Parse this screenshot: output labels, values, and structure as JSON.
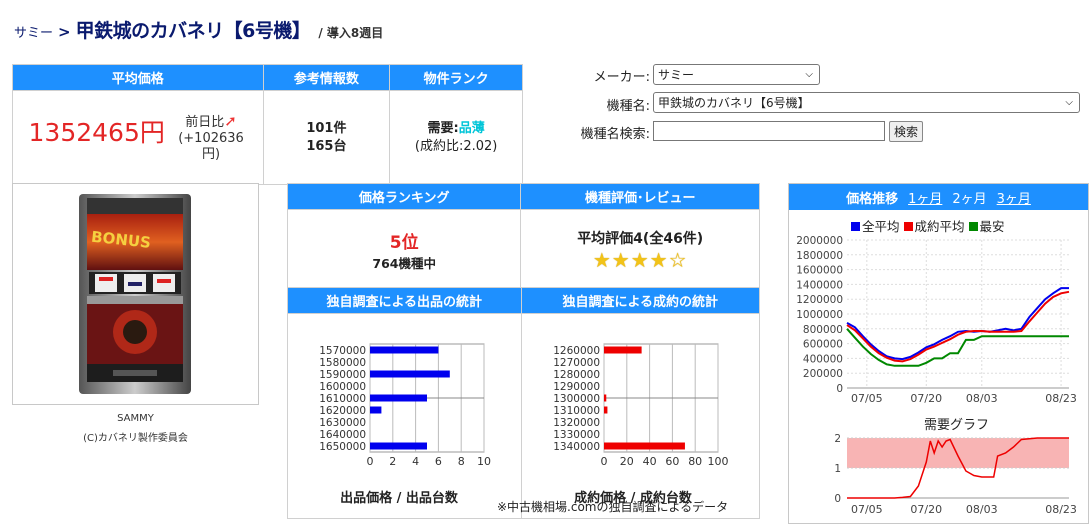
{
  "breadcrumb": {
    "maker": "サミー",
    "separator": ">",
    "title": "甲鉄城のカバネリ【6号機】",
    "subtitle": "/ 導入8週目"
  },
  "summary": {
    "headers": [
      "平均価格",
      "参考情報数",
      "物件ランク"
    ],
    "avg_price": "1352465円",
    "prev_label": "前日比",
    "prev_arrow": "➚",
    "prev_diff": "(+102636円)",
    "info_count": "101件",
    "info_units": "165台",
    "demand_label": "需要:",
    "demand_value": "品薄",
    "contract_ratio": "(成約比:2.02)"
  },
  "form": {
    "maker_label": "メーカー:",
    "maker_value": "サミー",
    "model_label": "機種名:",
    "model_value": "甲鉄城のカバネリ【6号機】",
    "search_label": "機種名検索:",
    "search_value": "",
    "search_button": "検索"
  },
  "machine": {
    "caption1": "SAMMY",
    "caption2": "(C)カバネリ製作委員会",
    "banner": "BONUS"
  },
  "rank": {
    "headers": [
      "価格ランキング",
      "機種評価･レビュー"
    ],
    "rank_value": "5位",
    "rank_total": "764機種中",
    "review_text": "平均評価4(全46件)",
    "stars": "★★★★☆"
  },
  "stats": {
    "headers": [
      "独自調査による出品の統計",
      "独自調査による成約の統計"
    ],
    "listing_caption": "出品価格 / 出品台数",
    "contract_caption": "成約価格 / 成約台数",
    "note": "※中古機相場.comの独自調査によるデータ"
  },
  "trend": {
    "title": "価格推移",
    "periods": [
      "1ヶ月",
      "2ヶ月",
      "3ヶ月"
    ],
    "legend": [
      {
        "label": "全平均",
        "color": "#0000ee"
      },
      {
        "label": "成約平均",
        "color": "#ee0000"
      },
      {
        "label": "最安",
        "color": "#008800"
      }
    ],
    "demand_title": "需要グラフ"
  },
  "chart_data": [
    {
      "type": "bar",
      "orientation": "horizontal",
      "categories": [
        "1570000",
        "1580000",
        "1590000",
        "1600000",
        "1610000",
        "1620000",
        "1630000",
        "1640000",
        "1650000"
      ],
      "values": [
        6,
        0,
        7,
        0,
        5,
        1,
        0,
        0,
        5
      ],
      "xlim": [
        0,
        10
      ],
      "xticks": [
        0,
        2,
        4,
        6,
        8,
        10
      ],
      "color": "#0000ee",
      "xlabel": "出品価格 / 出品台数"
    },
    {
      "type": "bar",
      "orientation": "horizontal",
      "categories": [
        "1260000",
        "1270000",
        "1280000",
        "1290000",
        "1300000",
        "1310000",
        "1320000",
        "1330000",
        "1340000"
      ],
      "values": [
        33,
        0,
        0,
        0,
        2,
        3,
        0,
        0,
        71
      ],
      "xlim": [
        0,
        100
      ],
      "xticks": [
        0,
        20,
        40,
        60,
        80,
        100
      ],
      "color": "#ee0000",
      "xlabel": "成約価格 / 成約台数"
    },
    {
      "type": "line",
      "x": [
        0,
        2,
        4,
        6,
        8,
        10,
        12,
        14,
        16,
        18,
        20,
        22,
        24,
        26,
        28,
        30,
        32,
        34,
        36,
        38,
        40,
        42,
        44,
        46,
        48,
        50,
        52,
        54,
        56
      ],
      "xticks": [
        {
          "pos": 5,
          "label": "07/05"
        },
        {
          "pos": 20,
          "label": "07/20"
        },
        {
          "pos": 34,
          "label": "08/03"
        },
        {
          "pos": 54,
          "label": "08/23"
        }
      ],
      "ylim": [
        0,
        2000000
      ],
      "yticks": [
        0,
        200000,
        400000,
        600000,
        800000,
        1000000,
        1200000,
        1400000,
        1600000,
        1800000,
        2000000
      ],
      "series": [
        {
          "name": "全平均",
          "color": "#0000ee",
          "values": [
            880000,
            820000,
            700000,
            590000,
            500000,
            430000,
            400000,
            390000,
            420000,
            480000,
            550000,
            590000,
            650000,
            700000,
            760000,
            770000,
            760000,
            770000,
            760000,
            780000,
            800000,
            780000,
            800000,
            960000,
            1080000,
            1200000,
            1280000,
            1350000,
            1350000
          ]
        },
        {
          "name": "成約平均",
          "color": "#ee0000",
          "values": [
            850000,
            780000,
            670000,
            560000,
            470000,
            410000,
            370000,
            360000,
            390000,
            450000,
            520000,
            560000,
            610000,
            660000,
            720000,
            760000,
            770000,
            770000,
            760000,
            760000,
            760000,
            760000,
            770000,
            900000,
            1020000,
            1140000,
            1230000,
            1280000,
            1300000
          ]
        },
        {
          "name": "最安",
          "color": "#008800",
          "values": [
            800000,
            680000,
            560000,
            460000,
            380000,
            320000,
            300000,
            300000,
            300000,
            300000,
            340000,
            400000,
            400000,
            470000,
            470000,
            650000,
            650000,
            700000,
            700000,
            700000,
            700000,
            700000,
            700000,
            700000,
            700000,
            700000,
            700000,
            700000,
            700000
          ]
        }
      ]
    },
    {
      "type": "line",
      "title": "需要グラフ",
      "x": [
        0,
        4,
        8,
        12,
        14,
        16,
        18,
        20,
        21,
        22,
        23,
        24,
        25,
        26,
        28,
        30,
        32,
        34,
        35,
        36,
        37,
        38,
        40,
        42,
        44,
        48,
        52,
        56
      ],
      "ylim": [
        0,
        2
      ],
      "yticks": [
        0,
        1,
        2
      ],
      "xticks": [
        {
          "pos": 5,
          "label": "07/05"
        },
        {
          "pos": 20,
          "label": "07/20"
        },
        {
          "pos": 34,
          "label": "08/03"
        },
        {
          "pos": 54,
          "label": "08/23"
        }
      ],
      "band": [
        1,
        2
      ],
      "series": [
        {
          "name": "",
          "color": "#ee0000",
          "values": [
            0,
            0,
            0,
            0,
            0.02,
            0.05,
            0.4,
            1.2,
            1.9,
            1.5,
            1.9,
            1.7,
            1.9,
            1.95,
            1.4,
            0.9,
            0.75,
            0.7,
            0.7,
            0.7,
            0.7,
            1.4,
            1.5,
            1.7,
            1.95,
            2,
            2,
            2
          ]
        }
      ]
    }
  ]
}
